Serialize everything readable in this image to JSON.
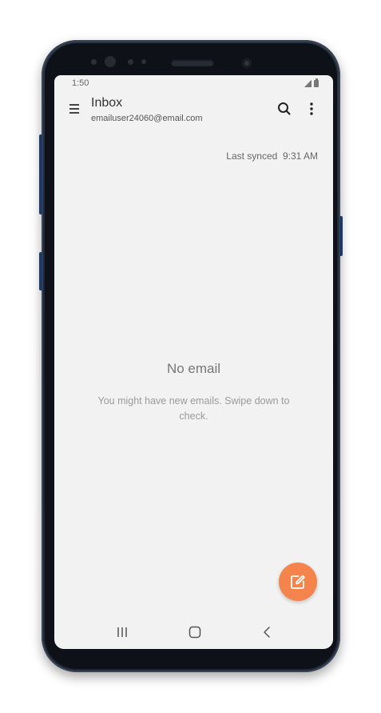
{
  "status_bar": {
    "time": "1:50"
  },
  "app_bar": {
    "title": "Inbox",
    "account": "emailuser24060@email.com"
  },
  "sync": {
    "label": "Last synced  9:31 AM"
  },
  "empty_state": {
    "title": "No email",
    "message": "You might have new emails. Swipe down to check."
  },
  "colors": {
    "fab": "#f4834c",
    "background": "#f2f2f2",
    "device_frame": "#1b2230"
  },
  "icons": {
    "menu": "menu-icon",
    "search": "search-icon",
    "more": "more-vertical-icon",
    "compose": "compose-icon",
    "recents": "recents-icon",
    "home": "home-icon",
    "back": "back-icon"
  }
}
